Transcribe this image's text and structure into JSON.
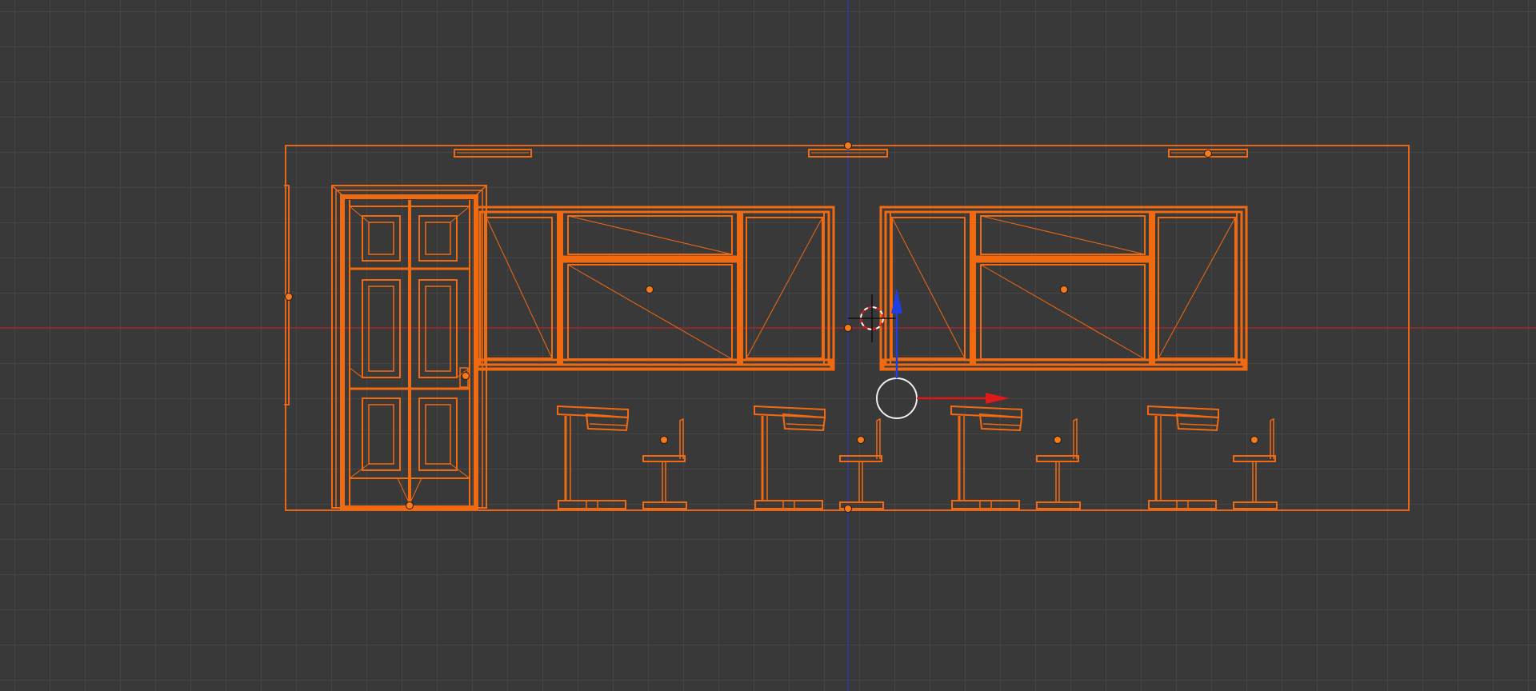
{
  "viewport": {
    "type": "3d-viewport",
    "view": "front-orthographic",
    "shading": "wireframe",
    "background_color": "#393939",
    "grid_color": "#464646"
  },
  "colors": {
    "selection": "#f26a10",
    "selection_thin": "#e8661a",
    "axis_x": "#a2232a",
    "axis_z": "#2a3a9c",
    "gizmo_x": "#e11818",
    "gizmo_z": "#1f3fe0",
    "origin_dot": "#f27a20",
    "cursor_red": "#e81818",
    "cursor_white": "#ffffff"
  },
  "scene_objects": [
    {
      "name": "room-outline",
      "kind": "box",
      "selected": true
    },
    {
      "name": "ceiling-light-left",
      "kind": "panel",
      "selected": true
    },
    {
      "name": "ceiling-light-center",
      "kind": "panel",
      "selected": true
    },
    {
      "name": "ceiling-light-right",
      "kind": "panel",
      "selected": true
    },
    {
      "name": "door",
      "kind": "door",
      "selected": true
    },
    {
      "name": "window-left",
      "kind": "window",
      "selected": true
    },
    {
      "name": "window-right",
      "kind": "window",
      "selected": true
    },
    {
      "name": "table-1",
      "kind": "table",
      "selected": true
    },
    {
      "name": "table-2",
      "kind": "table",
      "selected": true
    },
    {
      "name": "table-3",
      "kind": "table",
      "selected": true
    },
    {
      "name": "table-4",
      "kind": "table",
      "selected": true
    },
    {
      "name": "stool-1",
      "kind": "stool",
      "selected": true
    },
    {
      "name": "stool-2",
      "kind": "stool",
      "selected": true
    },
    {
      "name": "stool-3",
      "kind": "stool",
      "selected": true
    },
    {
      "name": "stool-4",
      "kind": "stool",
      "selected": true
    }
  ],
  "gizmo": {
    "mode": "translate",
    "axes": [
      "x",
      "z"
    ]
  },
  "cursor_3d": {
    "visible": true
  }
}
